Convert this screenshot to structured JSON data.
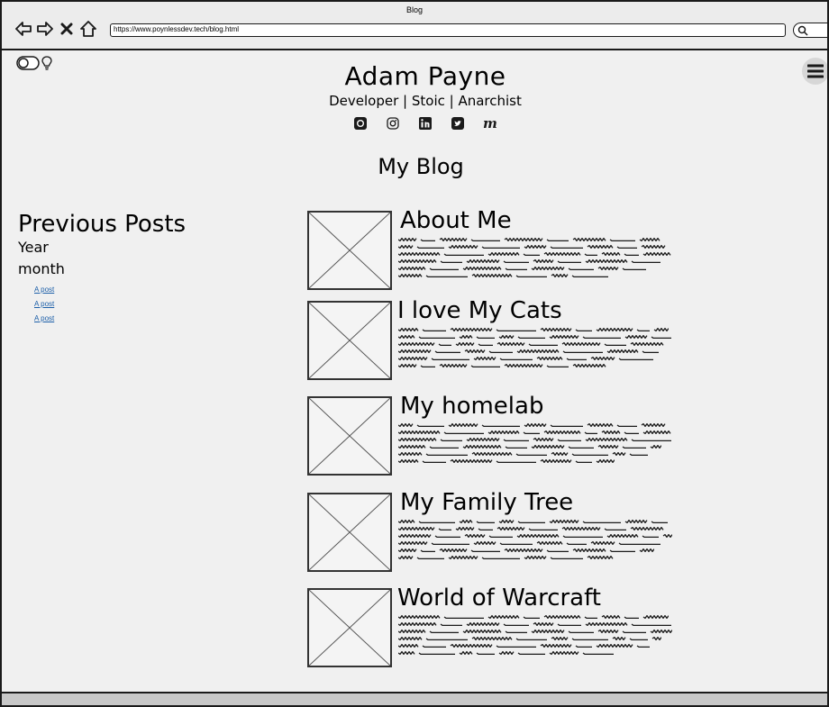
{
  "window": {
    "title": "Blog"
  },
  "browser": {
    "url": "https://www.poynlessdev.tech/blog.html"
  },
  "header": {
    "name": "Adam Payne",
    "tagline": "Developer | Stoic | Anarchist",
    "socials": [
      "github-icon",
      "instagram-icon",
      "linkedin-icon",
      "twitter-icon",
      "medium-icon"
    ]
  },
  "page": {
    "title": "My Blog"
  },
  "sidebar": {
    "heading": "Previous Posts",
    "year": "Year",
    "month": "month",
    "posts": [
      "A post",
      "A post",
      "A post"
    ]
  },
  "posts": [
    {
      "title": "About Me"
    },
    {
      "title": "I love My Cats"
    },
    {
      "title": "My homelab"
    },
    {
      "title": "My Family Tree"
    },
    {
      "title": "World of Warcraft"
    }
  ],
  "colors": {
    "background": "#f0f0f0",
    "link": "#1c5fa8",
    "border": "#1a1a1a"
  }
}
